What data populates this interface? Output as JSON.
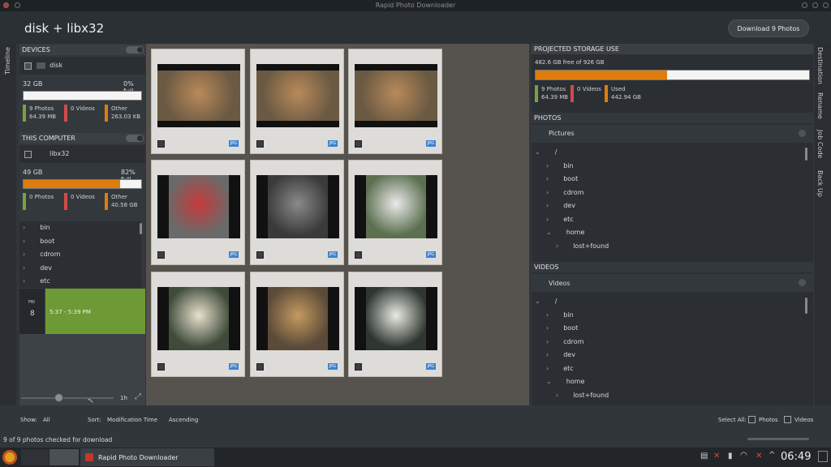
{
  "window": {
    "title": "Rapid Photo Downloader"
  },
  "header": {
    "title": "disk + libx32",
    "download_button": "Download 9 Photos"
  },
  "left_tabs": {
    "timeline": "Timeline"
  },
  "devices": {
    "section_title": "DEVICES",
    "device_name": "disk",
    "capacity": "32 GB",
    "percent_full": "0% full",
    "photos": "9 Photos",
    "photos_size": "64.39 MB",
    "videos": "0 Videos",
    "other": "Other",
    "other_size": "263.03 KB",
    "fill_fraction": 0.0
  },
  "this_computer": {
    "section_title": "THIS COMPUTER",
    "name": "libx32",
    "capacity": "49 GB",
    "percent_full": "82% full",
    "photos": "0 Photos",
    "videos": "0 Videos",
    "other": "Other",
    "other_size": "40.58 GB",
    "fill_fraction": 0.82,
    "tree": [
      "bin",
      "boot",
      "cdrom",
      "dev",
      "etc"
    ]
  },
  "timeline": {
    "day_abbr": "FRI",
    "day_num": "8",
    "range": "5:37 - 5:39 PM",
    "zoom_label": "1h"
  },
  "photos_grid": {
    "badge": "JPG",
    "count": 9
  },
  "projected": {
    "section_title": "PROJECTED STORAGE USE",
    "free_text": "482.6 GB free of 926 GB",
    "photos": "9 Photos",
    "photos_size": "64.39 MB",
    "videos": "0 Videos",
    "used": "Used",
    "used_size": "442.94 GB",
    "fill_fraction": 0.48
  },
  "photos_dest": {
    "section_title": "PHOTOS",
    "folder": "Pictures",
    "root": "/",
    "tree": [
      "bin",
      "boot",
      "cdrom",
      "dev",
      "etc",
      "home",
      "lost+found"
    ]
  },
  "videos_dest": {
    "section_title": "VIDEOS",
    "folder": "Videos",
    "root": "/",
    "tree": [
      "bin",
      "boot",
      "cdrom",
      "dev",
      "etc",
      "home",
      "lost+found"
    ]
  },
  "right_tabs": {
    "destination": "Destination",
    "rename": "Rename",
    "job_code": "Job Code",
    "back_up": "Back Up"
  },
  "bottom": {
    "show_label": "Show:",
    "show_value": "All",
    "sort_label": "Sort:",
    "sort_value": "Modification Time",
    "order_value": "Ascending",
    "select_all_label": "Select All:",
    "select_photos": "Photos",
    "select_videos": "Videos",
    "status": "9 of 9 photos checked for download"
  },
  "taskbar": {
    "app_label": "Rapid Photo Downloader",
    "clock": "06:49"
  },
  "colors": {
    "photos": "#7aa23c",
    "videos": "#d04b4b",
    "other": "#dd7d0d",
    "timeline_green": "#6d9a34",
    "accent_blue": "#3a84d0"
  }
}
